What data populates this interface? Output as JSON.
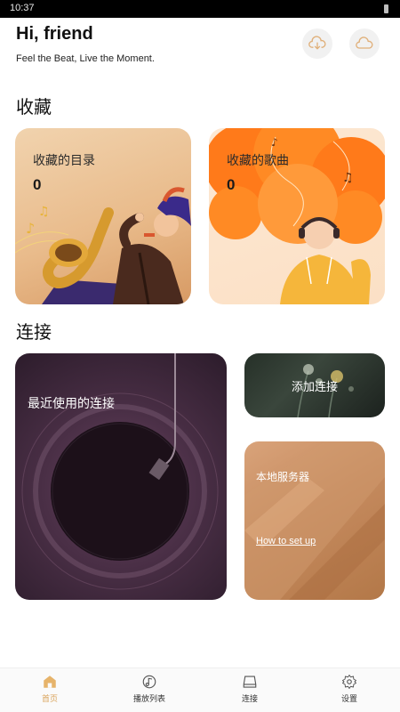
{
  "status_bar": {
    "time": "10:37"
  },
  "header": {
    "greeting": "Hi, friend",
    "tagline": "Feel the Beat, Live the Moment.",
    "cloud_buttons": [
      "cloud-download-icon",
      "cloud-icon"
    ]
  },
  "favorites": {
    "title": "收藏",
    "dirs": {
      "label": "收藏的目录",
      "count": "0"
    },
    "songs": {
      "label": "收藏的歌曲",
      "count": "0"
    }
  },
  "connections": {
    "title": "连接",
    "recent_label": "最近使用的连接",
    "add_label": "添加连接",
    "local_label": "本地服务器",
    "howto_label": "How to set up"
  },
  "bottom_nav": {
    "items": [
      {
        "label": "首页",
        "icon": "home-icon",
        "active": true
      },
      {
        "label": "播放列表",
        "icon": "playlist-icon",
        "active": false
      },
      {
        "label": "连接",
        "icon": "drive-icon",
        "active": false
      },
      {
        "label": "设置",
        "icon": "settings-icon",
        "active": false
      }
    ]
  },
  "colors": {
    "accent": "#d9a35a",
    "cloud_icon": "#e0b07a"
  }
}
